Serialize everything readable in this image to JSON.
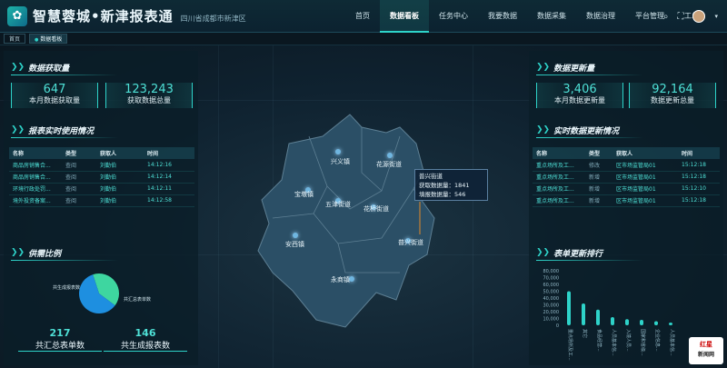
{
  "header": {
    "logo_icon": "leaf-icon",
    "title": "智慧蓉城•新津报表通",
    "subtitle": "四川省成都市新津区",
    "nav": [
      "首页",
      "数据看板",
      "任务中心",
      "我要数据",
      "数据采集",
      "数据治理",
      "平台管理",
      "工单"
    ],
    "active_nav": "数据看板"
  },
  "tabs": [
    "首页",
    "数据看板"
  ],
  "left": {
    "acquire": {
      "title": "数据获取量",
      "month_value": "647",
      "month_label": "本月数据获取量",
      "total_value": "123,243",
      "total_label": "获取数据总量"
    },
    "usage": {
      "title": "报表实时使用情况",
      "headers": [
        "名称",
        "类型",
        "获取人",
        "时间"
      ],
      "rows": [
        [
          "商品房销售合...",
          "查阅",
          "刘勤伯",
          "14:12:16"
        ],
        [
          "商品房销售合...",
          "查阅",
          "刘勤伯",
          "14:12:14"
        ],
        [
          "环境行政处罚...",
          "查阅",
          "刘勤伯",
          "14:12:11"
        ],
        [
          "境外投资备案...",
          "查阅",
          "刘勤伯",
          "14:12:58"
        ]
      ]
    },
    "supply": {
      "title": "供需比例",
      "legend_a": "共生成报表数",
      "legend_b": "共汇总表单数",
      "summary_value": "217",
      "summary_label": "共汇总表单数",
      "generated_value": "146",
      "generated_label": "共生成报表数"
    }
  },
  "right": {
    "update": {
      "title": "数据更新量",
      "month_value": "3,406",
      "month_label": "本月数据更新量",
      "total_value": "92,164",
      "total_label": "数据更新总量"
    },
    "realtime": {
      "title": "实时数据更新情况",
      "headers": [
        "名称",
        "类型",
        "获取人",
        "时间"
      ],
      "rows": [
        [
          "重点场所及工...",
          "修改",
          "区市场监管局01",
          "15:12:18"
        ],
        [
          "重点场所及工...",
          "新增",
          "区市场监管局01",
          "15:12:18"
        ],
        [
          "重点场所及工...",
          "新增",
          "区市场监管局01",
          "15:12:10"
        ],
        [
          "重点场所及工...",
          "新增",
          "区市场监管局01",
          "15:12:18"
        ]
      ]
    },
    "ranking": {
      "title": "表单更新排行"
    }
  },
  "map": {
    "towns": [
      "兴义镇",
      "花源街道",
      "宝墩镇",
      "五津街道",
      "花桥街道",
      "安西镇",
      "普兴街道",
      "永商镇"
    ],
    "tooltip": {
      "name": "普兴街道",
      "acquire_label": "获取数据量：",
      "acquire_value": "1841",
      "fill_label": "填报数据量：",
      "fill_value": "546"
    }
  },
  "badge": {
    "line1": "红星",
    "line2": "新闻网"
  },
  "chart_data": {
    "type": "bar",
    "title": "表单更新排行",
    "categories": [
      "重点场所及工...",
      "其它",
      "食品经营...",
      "人员基本信...",
      "入境人员...",
      "国家和省级...",
      "企业信息...",
      "人员基本信..."
    ],
    "values": [
      50000,
      32000,
      23000,
      12000,
      9000,
      8000,
      6000,
      4000
    ],
    "ylim": [
      0,
      80000
    ],
    "yticks": [
      "80,000",
      "70,000",
      "60,000",
      "50,000",
      "40,000",
      "30,000",
      "20,000",
      "10,000",
      "0"
    ],
    "bar_color": "#2ed3c9"
  },
  "pie": {
    "values": [
      146,
      217
    ],
    "colors": [
      "#3ed6a0",
      "#1e8fe0"
    ]
  }
}
